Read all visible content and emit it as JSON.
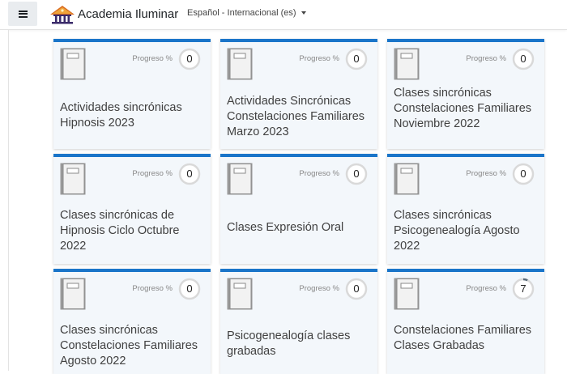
{
  "header": {
    "menu_icon": "hamburger-icon",
    "brand_name": "Academia Iluminar",
    "language": "Español - Internacional (es)"
  },
  "courses": [
    {
      "title": "Actividades sincrónicas Hipnosis 2023",
      "progress_label": "Progreso %",
      "progress": "0"
    },
    {
      "title": "Actividades Sincrónicas Constelaciones Familiares Marzo 2023",
      "progress_label": "Progreso %",
      "progress": "0"
    },
    {
      "title": "Clases sincrónicas Constelaciones Familiares Noviembre 2022",
      "progress_label": "Progreso %",
      "progress": "0"
    },
    {
      "title": "Clases sincrónicas de Hipnosis Ciclo Octubre 2022",
      "progress_label": "Progreso %",
      "progress": "0"
    },
    {
      "title": "Clases Expresión Oral",
      "progress_label": "Progreso %",
      "progress": "0"
    },
    {
      "title": "Clases sincrónicas Psicogenealogía Agosto 2022",
      "progress_label": "Progreso %",
      "progress": "0"
    },
    {
      "title": "Clases sincrónicas Constelaciones Familiares Agosto 2022",
      "progress_label": "Progreso %",
      "progress": "0"
    },
    {
      "title": "Psicogenealogía clases grabadas",
      "progress_label": "Progreso %",
      "progress": "0"
    },
    {
      "title": "Constelaciones Familiares Clases Grabadas",
      "progress_label": "Progreso %",
      "progress": "7"
    }
  ],
  "colors": {
    "card_accent": "#1a75c9",
    "card_background": "#f3f7fb",
    "progress_ring": "#d9d9d9",
    "progress_fill": "#5a6b7a"
  },
  "icons": {
    "course_icon": "notebook-icon",
    "brand_logo": "temple-logo-icon"
  }
}
